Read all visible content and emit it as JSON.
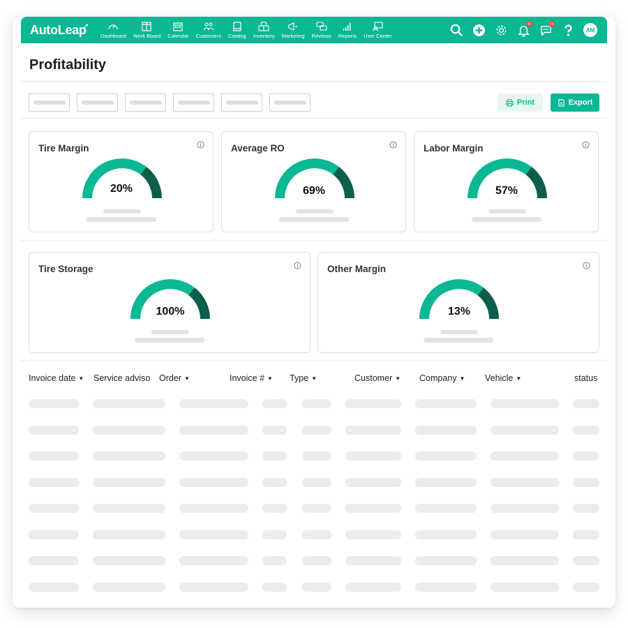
{
  "app": {
    "logo": "AutoLeap",
    "nav": [
      {
        "label": "Dashboard",
        "icon": "speedometer-icon"
      },
      {
        "label": "Work Board",
        "icon": "board-icon"
      },
      {
        "label": "Calendar",
        "icon": "calendar-icon"
      },
      {
        "label": "Customers",
        "icon": "customers-icon"
      },
      {
        "label": "Catalog",
        "icon": "book-icon"
      },
      {
        "label": "Inventory",
        "icon": "boxes-icon"
      },
      {
        "label": "Marketing",
        "icon": "megaphone-icon"
      },
      {
        "label": "Reviews",
        "icon": "chat-bubbles-icon"
      },
      {
        "label": "Reports",
        "icon": "bar-chart-icon"
      },
      {
        "label": "User Center",
        "icon": "user-center-icon"
      }
    ],
    "actions": {
      "notification_count": "6",
      "message_count": "74",
      "avatar_initials": "AM"
    }
  },
  "page": {
    "title": "Profitability",
    "print_label": "Print",
    "export_label": "Export"
  },
  "colors": {
    "brand": "#0ab893",
    "gauge_dark": "#0b5e4c"
  },
  "kpis": [
    {
      "title": "Tire Margin",
      "value": "20%"
    },
    {
      "title": "Average RO",
      "value": "69%"
    },
    {
      "title": "Labor Margin",
      "value": "57%"
    },
    {
      "title": "Tire Storage",
      "value": "100%"
    },
    {
      "title": "Other Margin",
      "value": "13%"
    }
  ],
  "table": {
    "columns": [
      {
        "label": "Invoice date",
        "sortable": true
      },
      {
        "label": "Service adviso",
        "sortable": false
      },
      {
        "label": "Order",
        "sortable": true
      },
      {
        "label": "Invoice #",
        "sortable": true
      },
      {
        "label": "Type",
        "sortable": true
      },
      {
        "label": "Customer",
        "sortable": true
      },
      {
        "label": "Company",
        "sortable": true
      },
      {
        "label": "Vehicle",
        "sortable": true
      },
      {
        "label": "status",
        "sortable": false
      }
    ]
  }
}
